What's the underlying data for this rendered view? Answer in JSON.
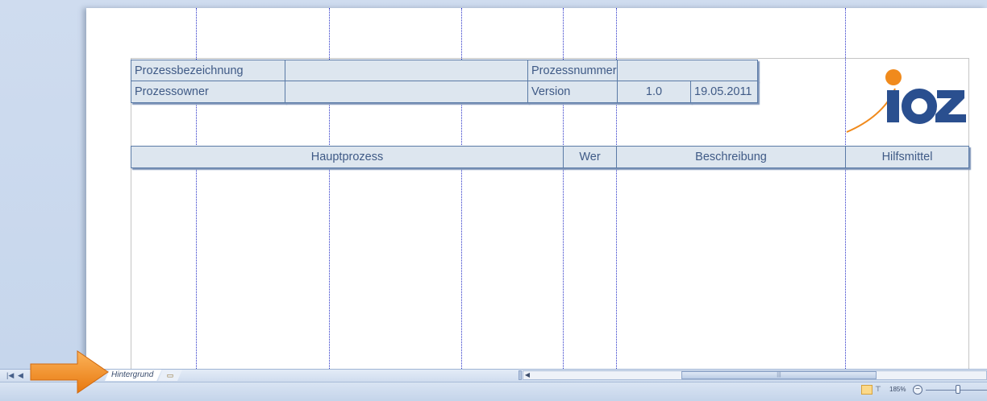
{
  "table_header": {
    "row1": {
      "label1": "Prozessbezeichnung",
      "value1": "",
      "label2": "Prozessnummer",
      "value2": ""
    },
    "row2": {
      "label1": "Prozessowner",
      "value1": "",
      "label2": "Version",
      "version": "1.0",
      "date": "19.05.2011"
    }
  },
  "columns": {
    "main_process": "Hauptprozess",
    "who": "Wer",
    "description": "Beschreibung",
    "tools": "Hilfsmittel"
  },
  "logo": {
    "text": "ioz",
    "colors": {
      "letters": "#2a4f8f",
      "accent": "#f08a1c"
    }
  },
  "sheet_tabs": [
    {
      "label": "Hintergrund",
      "active": true
    }
  ],
  "new_tab_icon": "insert-page-icon",
  "status": {
    "zoom": "185%"
  },
  "colors": {
    "cell_fill": "#dde6ef",
    "cell_border": "#5a7aa6",
    "cell_text": "#3f5a86",
    "guide": "#2b34c8",
    "arrow": "#f39a22"
  }
}
